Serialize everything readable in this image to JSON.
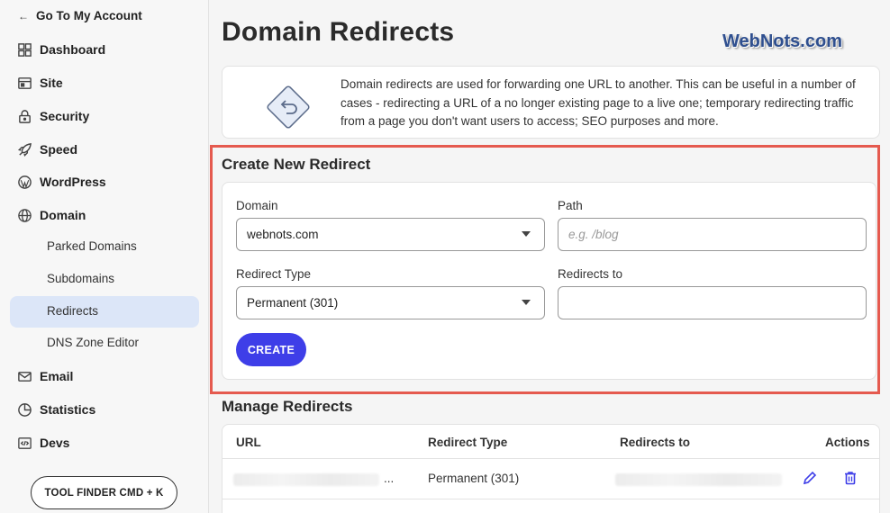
{
  "sidebar": {
    "back_label": "Go To My Account",
    "items": [
      {
        "label": "Dashboard",
        "icon": "grid-icon"
      },
      {
        "label": "Site",
        "icon": "browser-icon"
      },
      {
        "label": "Security",
        "icon": "lock-icon"
      },
      {
        "label": "Speed",
        "icon": "rocket-icon"
      },
      {
        "label": "WordPress",
        "icon": "wordpress-icon"
      },
      {
        "label": "Domain",
        "icon": "globe-icon"
      },
      {
        "label": "Email",
        "icon": "envelope-icon"
      },
      {
        "label": "Statistics",
        "icon": "pie-chart-icon"
      },
      {
        "label": "Devs",
        "icon": "code-icon"
      }
    ],
    "domain_subitems": [
      {
        "label": "Parked Domains"
      },
      {
        "label": "Subdomains"
      },
      {
        "label": "Redirects",
        "active": true
      },
      {
        "label": "DNS Zone Editor"
      }
    ],
    "tool_finder_label": "TOOL FINDER CMD + K"
  },
  "main": {
    "title": "Domain Redirects",
    "watermark": "WebNots.com",
    "info_text": "Domain redirects are used for forwarding one URL to another. This can be useful in a number of cases - redirecting a URL of a no longer existing page to a live one; temporary redirecting traffic from a page you don't want users to access; SEO purposes and more.",
    "create": {
      "title": "Create New Redirect",
      "domain_label": "Domain",
      "domain_value": "webnots.com",
      "path_label": "Path",
      "path_placeholder": "e.g. /blog",
      "redirect_type_label": "Redirect Type",
      "redirect_type_value": "Permanent (301)",
      "redirects_to_label": "Redirects to",
      "redirects_to_value": "",
      "button_label": "CREATE"
    },
    "manage": {
      "title": "Manage Redirects",
      "columns": [
        "URL",
        "Redirect Type",
        "Redirects to",
        "Actions"
      ],
      "rows": [
        {
          "url_suffix": "...",
          "type": "Permanent (301)"
        }
      ]
    }
  },
  "colors": {
    "accent": "#3e3ee8",
    "highlight_border": "#e55a4f",
    "active_nav_bg": "#dce6f8"
  }
}
